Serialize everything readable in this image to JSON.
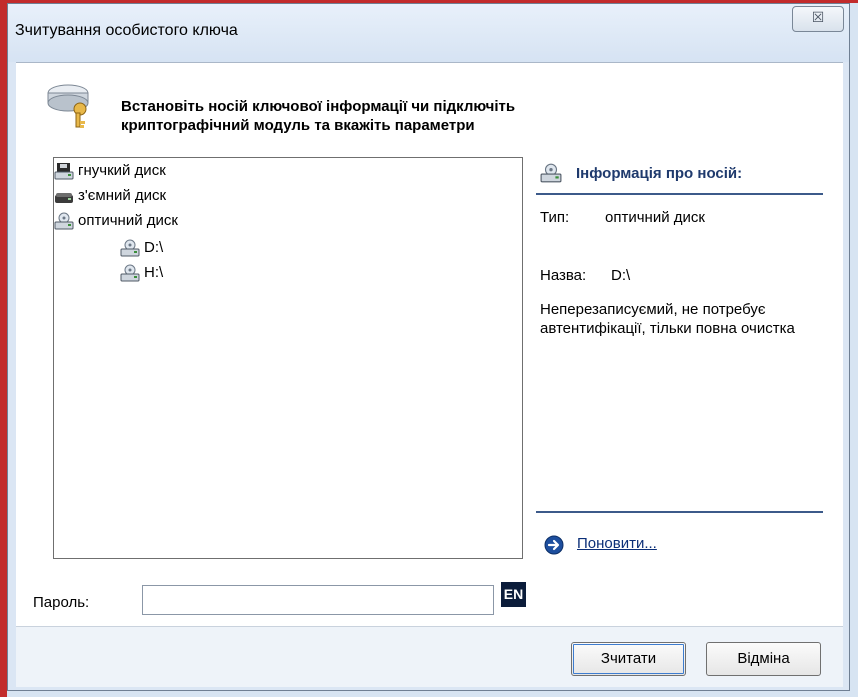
{
  "window": {
    "title": "Зчитування особистого ключа",
    "close_symbol": "☒"
  },
  "header": {
    "icon": "key-drive-icon",
    "line1": "Встановіть носій ключової інформації чи підключіть",
    "line2": "криптографічний модуль та вкажіть параметри"
  },
  "tree": {
    "items": [
      {
        "label": "гнучкий диск",
        "icon": "floppy-drive-icon"
      },
      {
        "label": "з'ємний диск",
        "icon": "removable-drive-icon"
      },
      {
        "label": "оптичний диск",
        "icon": "optical-drive-icon"
      },
      {
        "label": "D:\\",
        "icon": "optical-drive-icon"
      },
      {
        "label": "H:\\",
        "icon": "optical-drive-icon"
      }
    ]
  },
  "info": {
    "title": "Інформація про носій:",
    "type_label": "Тип:",
    "type_value": "оптичний диск",
    "name_label": "Назва:",
    "name_value": "D:\\",
    "description": "Неперезаписуємий, не потребує автентифікації, тільки повна очистка",
    "refresh_label": "Поновити..."
  },
  "password": {
    "label": "Пароль:",
    "value": "",
    "language": "EN"
  },
  "buttons": {
    "read": "Зчитати",
    "cancel": "Відміна"
  },
  "colors": {
    "link": "#0b2f78",
    "accent": "#1f3a6d",
    "badge_bg": "#0b1c3a"
  }
}
